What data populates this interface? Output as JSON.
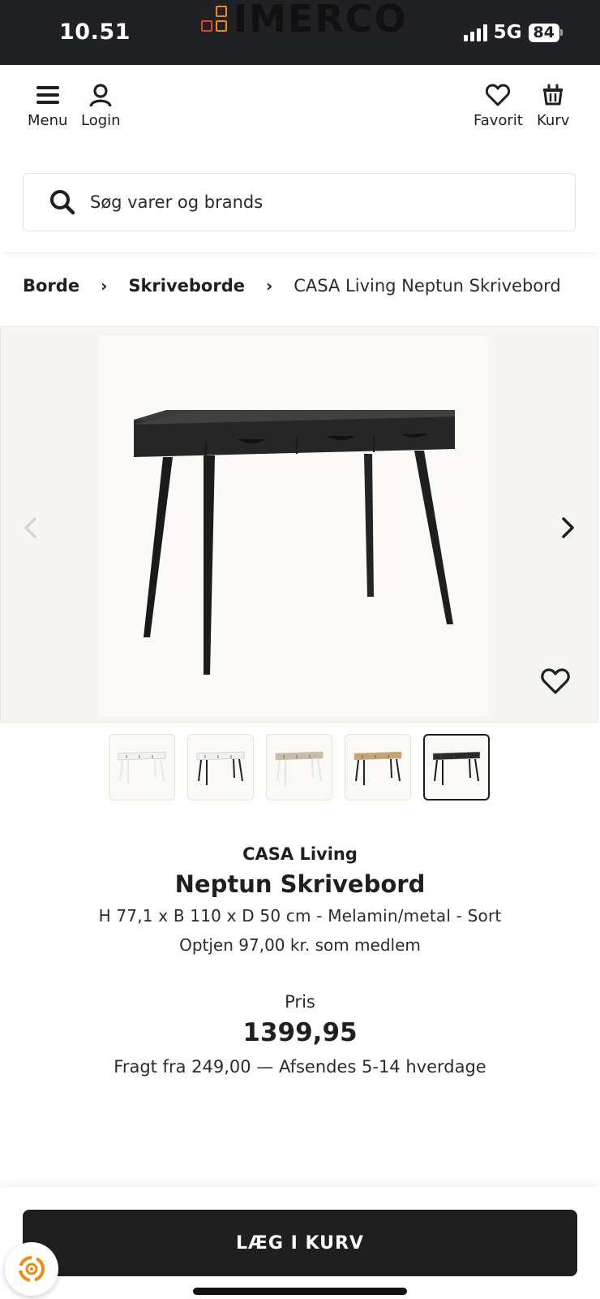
{
  "status_bar": {
    "time": "10.51",
    "network": "5G",
    "battery": "84"
  },
  "header": {
    "menu_label": "Menu",
    "login_label": "Login",
    "logo_text": "IMERCO",
    "favorite_label": "Favorit",
    "cart_label": "Kurv"
  },
  "search": {
    "placeholder": "Søg varer og brands"
  },
  "breadcrumb": [
    "Borde",
    "Skriveborde",
    "CASA Living Neptun Skrivebord"
  ],
  "product": {
    "brand": "CASA Living",
    "name": "Neptun Skrivebord",
    "specs": "H 77,1 x B 110 x D 50 cm - Melamin/metal - Sort",
    "member_earn": "Optjen 97,00 kr. som medlem",
    "price_label": "Pris",
    "price": "1399,95",
    "shipping": "Fragt fra 249,00 — Afsendes 5-14 hverdage"
  },
  "thumbnails": [
    {
      "variant": "white",
      "top": "#f2f2f2",
      "legs": "#e8e8e8"
    },
    {
      "variant": "white-black-legs",
      "top": "#f0f0f0",
      "legs": "#222222"
    },
    {
      "variant": "oak-white-legs",
      "top": "#c9bca6",
      "legs": "#e5e5e5"
    },
    {
      "variant": "oak-black-legs",
      "top": "#c8a36c",
      "legs": "#222222"
    },
    {
      "variant": "black",
      "top": "#2a2a2a",
      "legs": "#1a1a1a",
      "active": true
    }
  ],
  "cta": {
    "add_to_cart": "LÆG I KURV"
  },
  "colors": {
    "dark": "#1f1f1f",
    "status_bar": "#202124",
    "logo_orange": "#f08a16",
    "logo_red": "#e0422a"
  }
}
